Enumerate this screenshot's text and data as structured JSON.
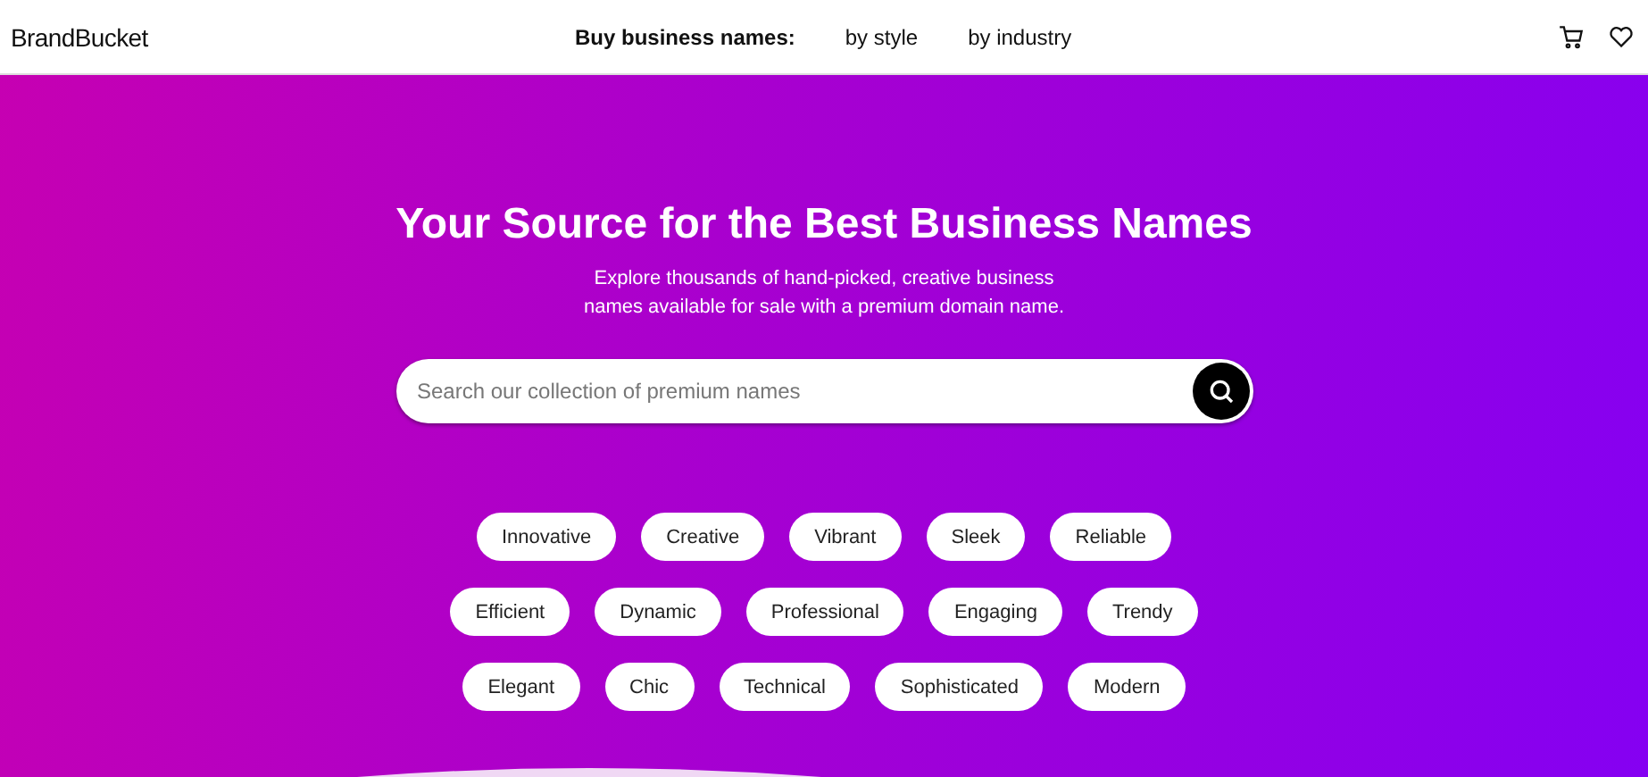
{
  "header": {
    "logo": "BrandBucket",
    "nav_label": "Buy business names:",
    "nav_links": [
      "by style",
      "by industry"
    ]
  },
  "hero": {
    "title": "Your Source for the Best Business Names",
    "subtitle_lines": [
      "Explore thousands of hand-picked, creative business",
      "names available for sale with a premium domain name."
    ],
    "search": {
      "placeholder": "Search our collection of premium names"
    },
    "tag_rows": [
      [
        "Innovative",
        "Creative",
        "Vibrant",
        "Sleek",
        "Reliable"
      ],
      [
        "Efficient",
        "Dynamic",
        "Professional",
        "Engaging",
        "Trendy"
      ],
      [
        "Elegant",
        "Chic",
        "Technical",
        "Sophisticated",
        "Modern"
      ]
    ]
  }
}
